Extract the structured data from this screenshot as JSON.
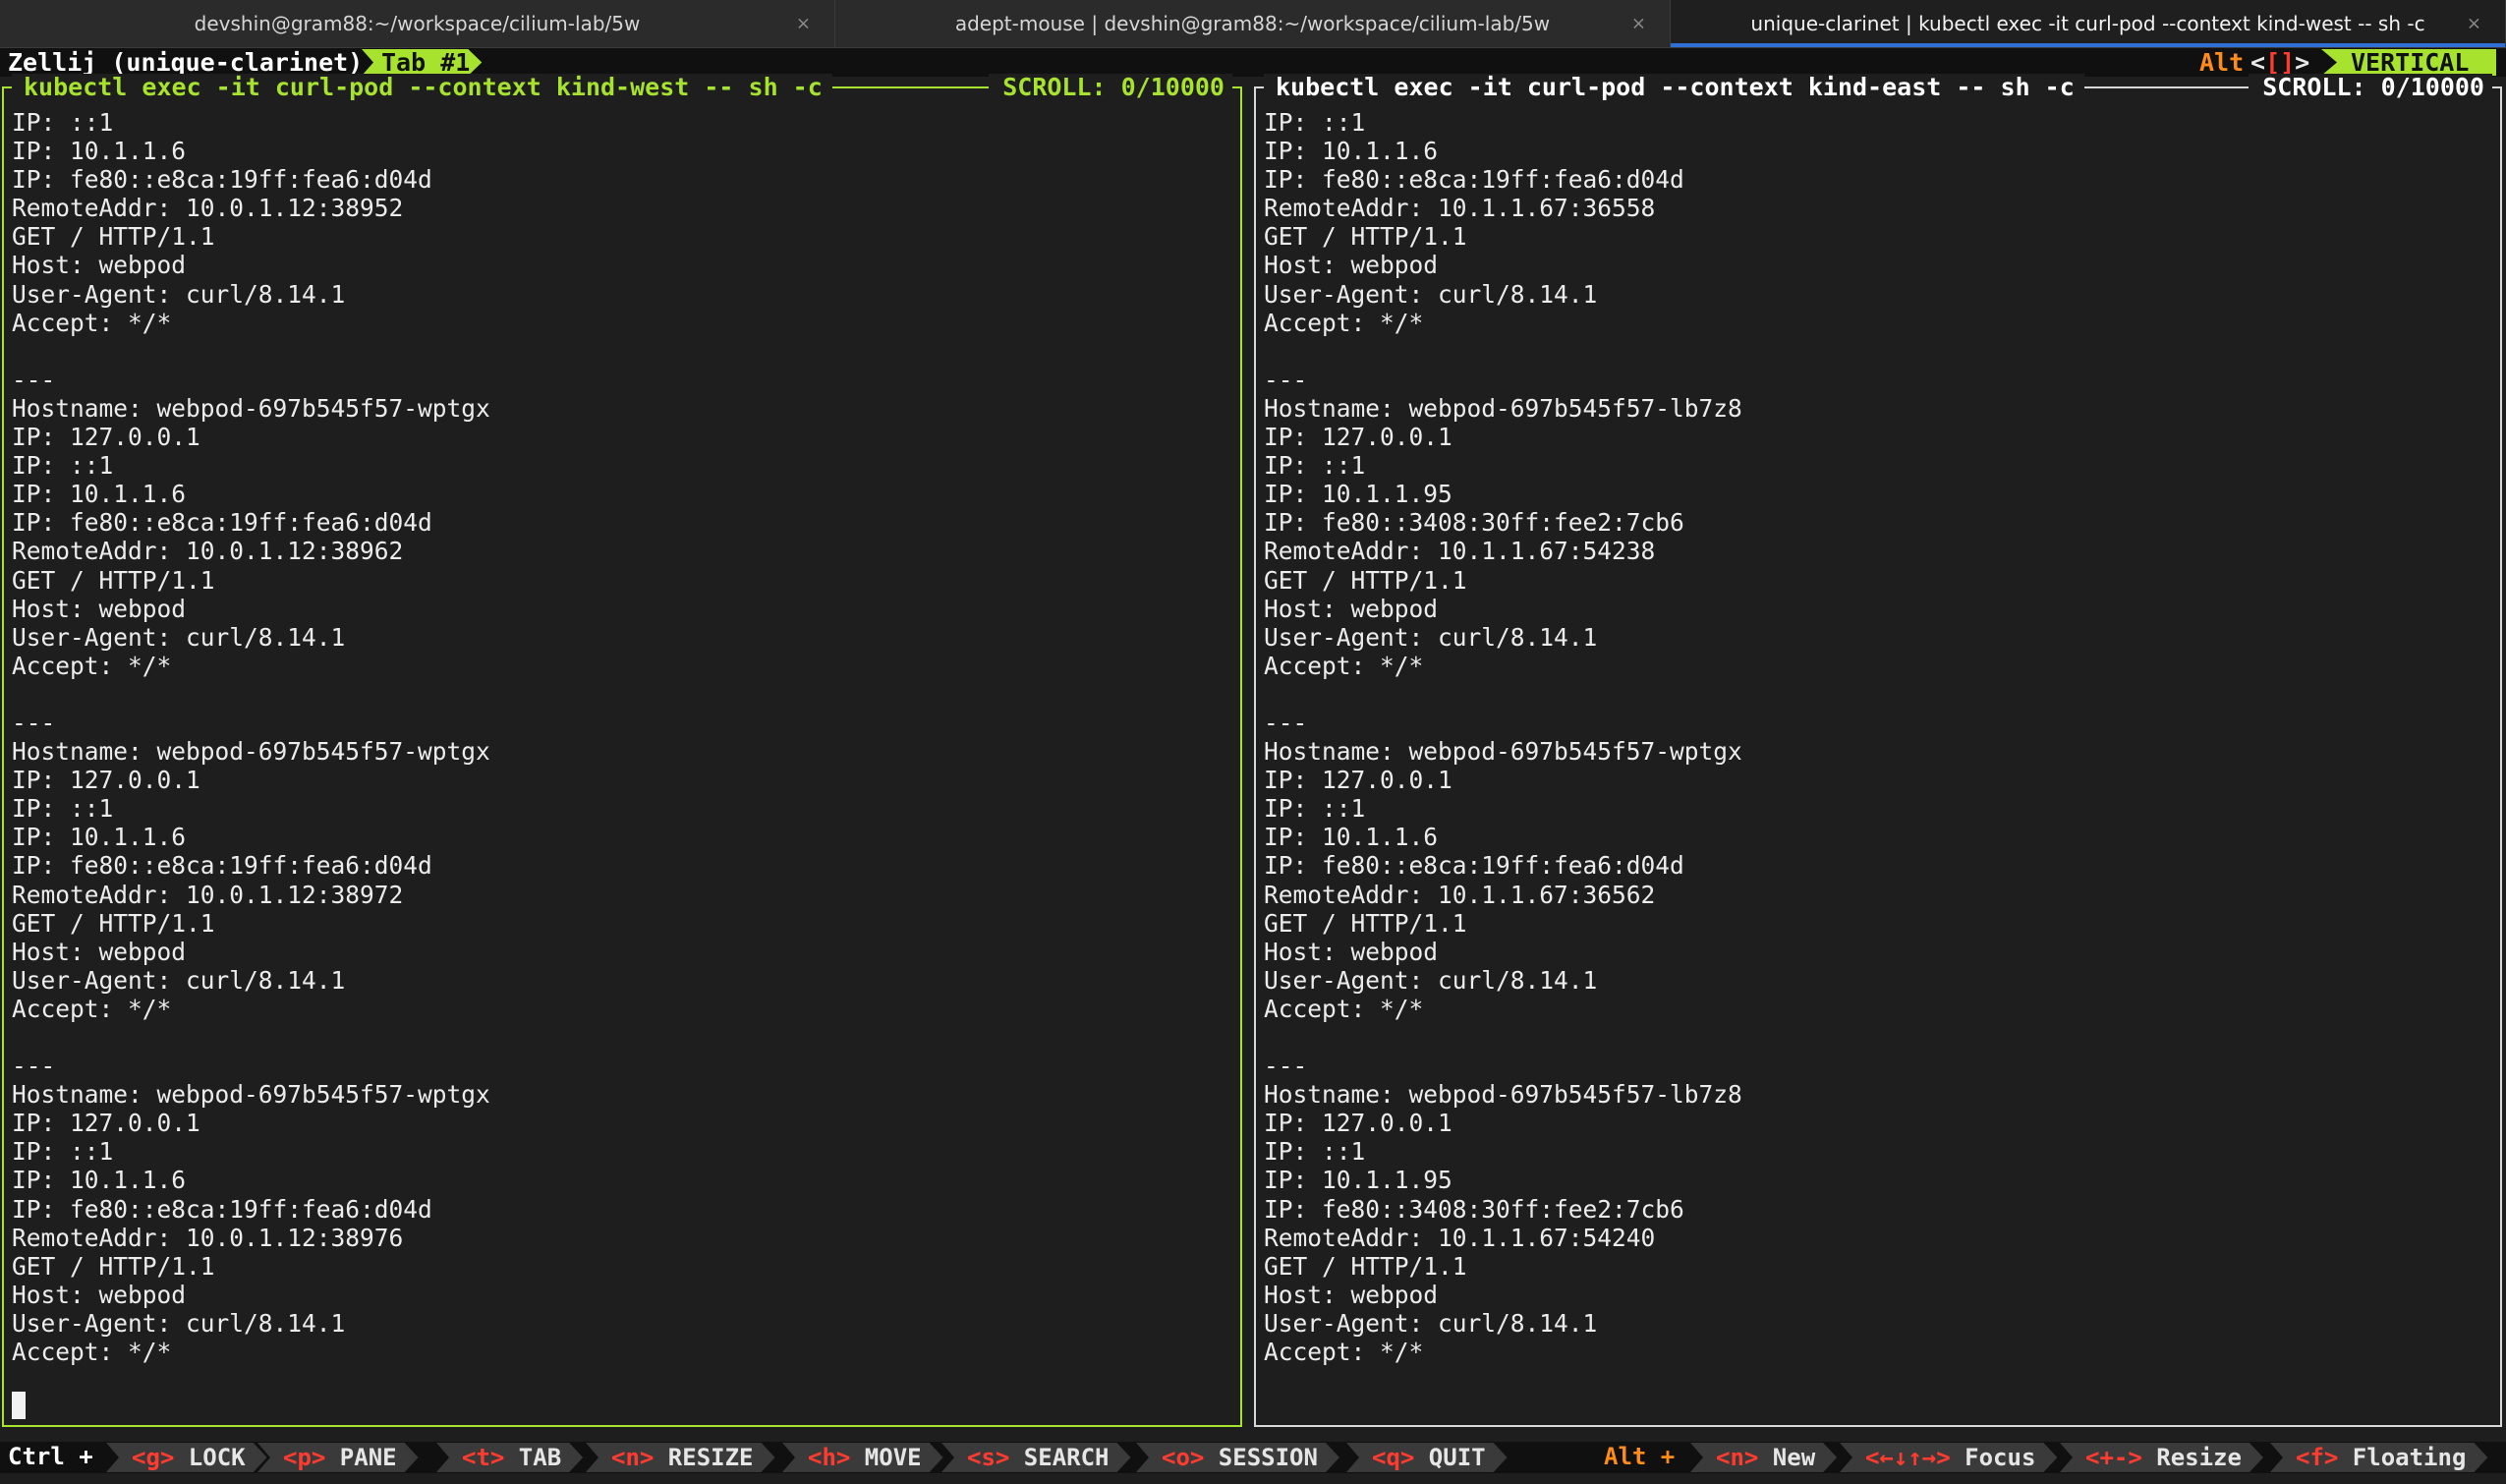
{
  "window_tabs": [
    {
      "title": "devshin@gram88:~/workspace/cilium-lab/5w",
      "close": "×",
      "active": false
    },
    {
      "title": "adept-mouse | devshin@gram88:~/workspace/cilium-lab/5w",
      "close": "×",
      "active": false
    },
    {
      "title": "unique-clarinet | kubectl exec -it curl-pod --context kind-west -- sh -c",
      "close": "×",
      "active": true
    }
  ],
  "zellij_bar": {
    "session": "Zellij (unique-clarinet)",
    "tab": "Tab #1",
    "alt_label": "Alt",
    "alt_open": "<",
    "alt_brackets": "[]",
    "alt_close": ">",
    "layout": "VERTICAL"
  },
  "panes": {
    "left": {
      "title": "kubectl exec -it curl-pod --context kind-west -- sh -c",
      "scroll": "SCROLL:  0/10000",
      "lines": [
        "IP: ::1",
        "IP: 10.1.1.6",
        "IP: fe80::e8ca:19ff:fea6:d04d",
        "RemoteAddr: 10.0.1.12:38952",
        "GET / HTTP/1.1",
        "Host: webpod",
        "User-Agent: curl/8.14.1",
        "Accept: */*",
        "",
        "---",
        "Hostname: webpod-697b545f57-wptgx",
        "IP: 127.0.0.1",
        "IP: ::1",
        "IP: 10.1.1.6",
        "IP: fe80::e8ca:19ff:fea6:d04d",
        "RemoteAddr: 10.0.1.12:38962",
        "GET / HTTP/1.1",
        "Host: webpod",
        "User-Agent: curl/8.14.1",
        "Accept: */*",
        "",
        "---",
        "Hostname: webpod-697b545f57-wptgx",
        "IP: 127.0.0.1",
        "IP: ::1",
        "IP: 10.1.1.6",
        "IP: fe80::e8ca:19ff:fea6:d04d",
        "RemoteAddr: 10.0.1.12:38972",
        "GET / HTTP/1.1",
        "Host: webpod",
        "User-Agent: curl/8.14.1",
        "Accept: */*",
        "",
        "---",
        "Hostname: webpod-697b545f57-wptgx",
        "IP: 127.0.0.1",
        "IP: ::1",
        "IP: 10.1.1.6",
        "IP: fe80::e8ca:19ff:fea6:d04d",
        "RemoteAddr: 10.0.1.12:38976",
        "GET / HTTP/1.1",
        "Host: webpod",
        "User-Agent: curl/8.14.1",
        "Accept: */*"
      ]
    },
    "right": {
      "title": "kubectl exec -it curl-pod --context kind-east -- sh -c",
      "scroll": "SCROLL:  0/10000",
      "lines": [
        "IP: ::1",
        "IP: 10.1.1.6",
        "IP: fe80::e8ca:19ff:fea6:d04d",
        "RemoteAddr: 10.1.1.67:36558",
        "GET / HTTP/1.1",
        "Host: webpod",
        "User-Agent: curl/8.14.1",
        "Accept: */*",
        "",
        "---",
        "Hostname: webpod-697b545f57-lb7z8",
        "IP: 127.0.0.1",
        "IP: ::1",
        "IP: 10.1.1.95",
        "IP: fe80::3408:30ff:fee2:7cb6",
        "RemoteAddr: 10.1.1.67:54238",
        "GET / HTTP/1.1",
        "Host: webpod",
        "User-Agent: curl/8.14.1",
        "Accept: */*",
        "",
        "---",
        "Hostname: webpod-697b545f57-wptgx",
        "IP: 127.0.0.1",
        "IP: ::1",
        "IP: 10.1.1.6",
        "IP: fe80::e8ca:19ff:fea6:d04d",
        "RemoteAddr: 10.1.1.67:36562",
        "GET / HTTP/1.1",
        "Host: webpod",
        "User-Agent: curl/8.14.1",
        "Accept: */*",
        "",
        "---",
        "Hostname: webpod-697b545f57-lb7z8",
        "IP: 127.0.0.1",
        "IP: ::1",
        "IP: 10.1.1.95",
        "IP: fe80::3408:30ff:fee2:7cb6",
        "RemoteAddr: 10.1.1.67:54240",
        "GET / HTTP/1.1",
        "Host: webpod",
        "User-Agent: curl/8.14.1",
        "Accept: */*"
      ]
    }
  },
  "keybar": {
    "ctrl_label": "Ctrl +",
    "alt_label": "Alt +",
    "ctrl_keys": [
      {
        "key": "<g>",
        "label": "LOCK"
      },
      {
        "key": "<p>",
        "label": "PANE"
      },
      {
        "key": "<t>",
        "label": "TAB"
      },
      {
        "key": "<n>",
        "label": "RESIZE"
      },
      {
        "key": "<h>",
        "label": "MOVE"
      },
      {
        "key": "<s>",
        "label": "SEARCH"
      },
      {
        "key": "<o>",
        "label": "SESSION"
      },
      {
        "key": "<q>",
        "label": "QUIT"
      }
    ],
    "alt_keys": [
      {
        "key": "<n>",
        "label": "New"
      },
      {
        "key": "<←↓↑→>",
        "label": "Focus"
      },
      {
        "key": "<+->",
        "label": "Resize"
      },
      {
        "key": "<f>",
        "label": "Floating"
      }
    ]
  },
  "colors": {
    "accent_green": "#a6e22e",
    "alt_orange": "#ff8c1a",
    "key_red": "#ff3b30",
    "tab_underline": "#2f6fd6"
  }
}
